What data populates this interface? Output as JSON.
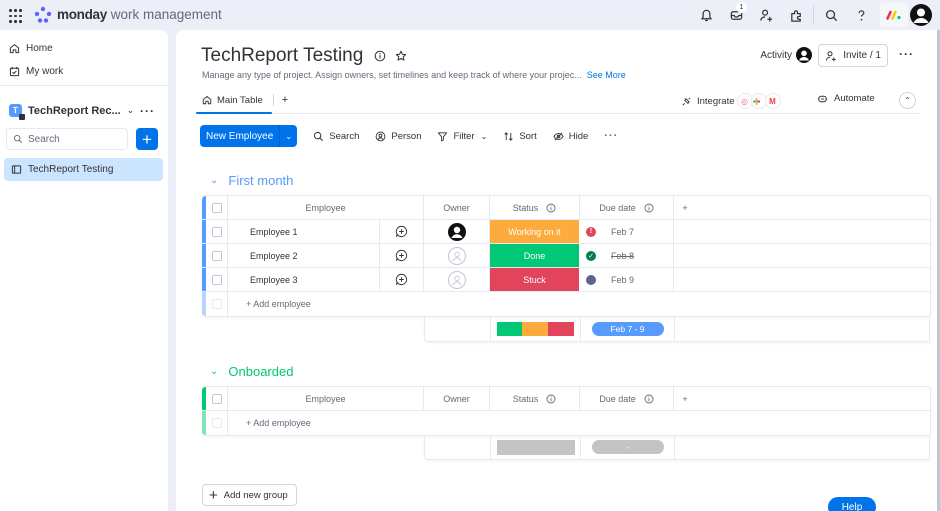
{
  "topbar": {
    "brand_bold": "monday",
    "brand_rest": " work management",
    "inbox_badge": "1",
    "icons": [
      "apps-grid-icon",
      "notifications-bell-icon",
      "inbox-icon",
      "invite-members-icon",
      "apps-marketplace-icon",
      "search-icon",
      "help-icon",
      "monday-logo-icon",
      "user-avatar"
    ]
  },
  "sidebar": {
    "items": [
      {
        "label": "Home",
        "icon": "home-icon"
      },
      {
        "label": "My work",
        "icon": "calendar-check-icon"
      }
    ],
    "workspace": {
      "initial": "T",
      "name": "TechReport Rec...",
      "color": "#579bfc"
    },
    "search_placeholder": "Search",
    "add_label": "+",
    "boards": [
      {
        "label": "TechReport Testing",
        "icon": "board-icon",
        "selected": true
      }
    ]
  },
  "board": {
    "title": "TechReport Testing",
    "description": "Manage any type of project. Assign owners, set timelines and keep track of where your projec...",
    "see_more": "See More",
    "activity_label": "Activity",
    "invite_label": "Invite / 1",
    "tabs": [
      {
        "label": "Main Table",
        "icon": "home-icon",
        "active": true
      }
    ],
    "add_view": "+",
    "integrate_label": "Integrate",
    "integrate_apps": [
      "G",
      "S",
      "M"
    ],
    "automate_label": "Automate"
  },
  "toolbar": {
    "new_item_label": "New Employee",
    "search_label": "Search",
    "person_label": "Person",
    "filter_label": "Filter",
    "sort_label": "Sort",
    "hide_label": "Hide",
    "more_label": "···"
  },
  "columns": {
    "item": "Employee",
    "owner": "Owner",
    "status": "Status",
    "due": "Due date",
    "add": "+"
  },
  "groups": [
    {
      "title": "First month",
      "color": "#579bfc",
      "rows": [
        {
          "name": "Employee 1",
          "owner": "assigned",
          "status": "Working on it",
          "status_color": "#fdab3d",
          "due_indicator": "overdue",
          "due_indicator_color": "#e2445c",
          "due_indicator_glyph": "!",
          "due": "Feb 7"
        },
        {
          "name": "Employee 2",
          "owner": "empty",
          "status": "Done",
          "status_color": "#00c875",
          "due_indicator": "done",
          "due_indicator_color": "#037f4c",
          "due_indicator_glyph": "✓",
          "due": "Feb 8"
        },
        {
          "name": "Employee 3",
          "owner": "empty",
          "status": "Stuck",
          "status_color": "#e2445c",
          "due_indicator": "upcoming",
          "due_indicator_color": "#5c6490",
          "due_indicator_glyph": "",
          "due": "Feb 9"
        }
      ],
      "add_item": "+ Add employee",
      "summary": {
        "status_distribution": [
          {
            "label": "Done",
            "color": "#00c875",
            "fraction": 0.333
          },
          {
            "label": "Working on it",
            "color": "#fdab3d",
            "fraction": 0.333
          },
          {
            "label": "Stuck",
            "color": "#e2445c",
            "fraction": 0.334
          }
        ],
        "timeline": "Feb 7 - 9",
        "timeline_color": "#579bfc"
      }
    },
    {
      "title": "Onboarded",
      "color": "#00c875",
      "rows": [],
      "add_item": "+ Add employee",
      "summary": {
        "status_distribution": [],
        "timeline": "-",
        "timeline_color": "#c4c4c4"
      }
    }
  ],
  "add_group_label": "Add new group",
  "help_label": "Help"
}
